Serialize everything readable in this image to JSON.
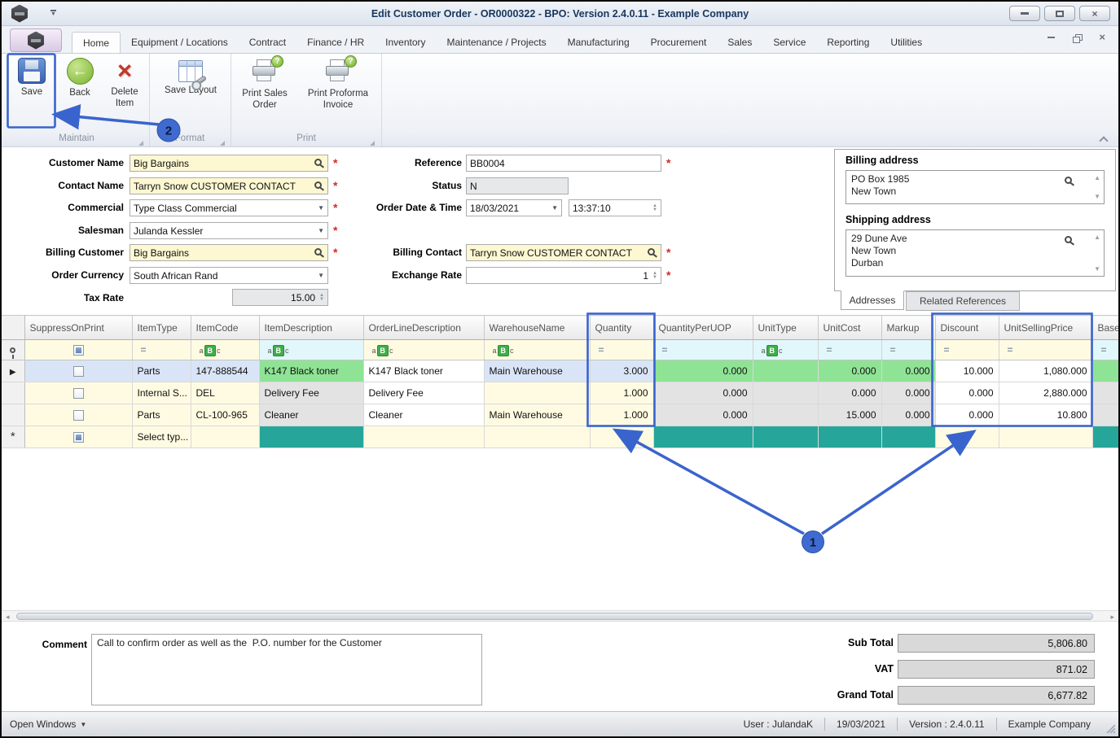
{
  "colors": {
    "annotation_blue": "#3a64cd",
    "field_yellow": "#fdf8d2",
    "cell_green": "#8fe395",
    "cell_teal": "#26a69a",
    "cell_gray": "#e3e3e3",
    "selected_row_blue": "#d9e5f7",
    "row_yellow": "#fffbe2",
    "filter_cyan": "#e2f7fb"
  },
  "window": {
    "title": "Edit Customer Order - OR0000322 - BPO: Version 2.4.0.11 - Example Company"
  },
  "ribbon": {
    "tabs": [
      "Home",
      "Equipment / Locations",
      "Contract",
      "Finance / HR",
      "Inventory",
      "Maintenance / Projects",
      "Manufacturing",
      "Procurement",
      "Sales",
      "Service",
      "Reporting",
      "Utilities"
    ],
    "buttons": {
      "save": "Save",
      "back": "Back",
      "delete_item": "Delete Item",
      "save_layout": "Save Layout",
      "print_sales_order": "Print Sales Order",
      "print_proforma_invoice": "Print Proforma Invoice"
    },
    "groups": {
      "maintain": "Maintain",
      "format": "Format",
      "print": "Print"
    }
  },
  "form": {
    "customer_name": {
      "label": "Customer Name",
      "value": "Big Bargains"
    },
    "contact_name": {
      "label": "Contact Name",
      "value": "Tarryn Snow CUSTOMER CONTACT"
    },
    "commercial": {
      "label": "Commercial",
      "value": "Type Class Commercial"
    },
    "salesman": {
      "label": "Salesman",
      "value": "Julanda Kessler"
    },
    "billing_customer": {
      "label": "Billing Customer",
      "value": "Big Bargains"
    },
    "order_currency": {
      "label": "Order Currency",
      "value": "South African Rand"
    },
    "tax_rate": {
      "label": "Tax Rate",
      "value": "15.00"
    },
    "reference": {
      "label": "Reference",
      "value": "BB0004"
    },
    "status": {
      "label": "Status",
      "value": "N"
    },
    "order_datetime": {
      "label": "Order Date & Time",
      "date": "18/03/2021",
      "time": "13:37:10"
    },
    "billing_contact": {
      "label": "Billing Contact",
      "value": "Tarryn Snow CUSTOMER CONTACT"
    },
    "exchange_rate": {
      "label": "Exchange Rate",
      "value": "1"
    }
  },
  "addresses": {
    "billing_label": "Billing address",
    "billing_value": "PO Box 1985\nNew Town",
    "shipping_label": "Shipping address",
    "shipping_value": "29 Dune Ave\nNew Town\nDurban",
    "tab_addresses": "Addresses",
    "tab_related": "Related References"
  },
  "grid": {
    "columns": [
      "SuppressOnPrint",
      "ItemType",
      "ItemCode",
      "ItemDescription",
      "OrderLineDescription",
      "WarehouseName",
      "Quantity",
      "QuantityPerUOP",
      "UnitType",
      "UnitCost",
      "Markup",
      "Discount",
      "UnitSellingPrice",
      "Base"
    ],
    "rows": [
      [
        "Parts",
        "147-888544",
        "K147 Black toner",
        "K147 Black toner",
        "Main Warehouse",
        "3.000",
        "0.000",
        "",
        "0.000",
        "0.000",
        "10.000",
        "1,080.000"
      ],
      [
        "Internal S...",
        "DEL",
        "Delivery Fee",
        "Delivery Fee",
        "",
        "1.000",
        "0.000",
        "",
        "0.000",
        "0.000",
        "0.000",
        "2,880.000"
      ],
      [
        "Parts",
        "CL-100-965",
        "Cleaner",
        "Cleaner",
        "Main Warehouse",
        "1.000",
        "0.000",
        "",
        "15.000",
        "0.000",
        "0.000",
        "10.800"
      ]
    ],
    "new_row_prompt": "Select typ..."
  },
  "footer": {
    "comment_label": "Comment",
    "comment": "Call to confirm order as well as the  P.O. number for the Customer",
    "sub_total_label": "Sub Total",
    "sub_total": "5,806.80",
    "vat_label": "VAT",
    "vat": "871.02",
    "grand_total_label": "Grand Total",
    "grand_total": "6,677.82"
  },
  "statusbar": {
    "open_windows": "Open Windows",
    "user": "User : JulandaK",
    "date": "19/03/2021",
    "version": "Version : 2.4.0.11",
    "company": "Example Company"
  },
  "annotations": {
    "callout_1": "1",
    "callout_2": "2"
  },
  "icons": {
    "dropdown": "▼",
    "spin_up": "▲",
    "spin_down": "▼",
    "scroll_up": "▲",
    "scroll_down": "▼",
    "scroll_left": "◂",
    "scroll_right": "▸",
    "selected_row": "▶",
    "new_row": "*",
    "eq": "=",
    "abc_a": "a",
    "abc_b": "B",
    "abc_c": "c",
    "question": "?",
    "back_arrow": "←",
    "close_x": "×",
    "required": "*"
  }
}
